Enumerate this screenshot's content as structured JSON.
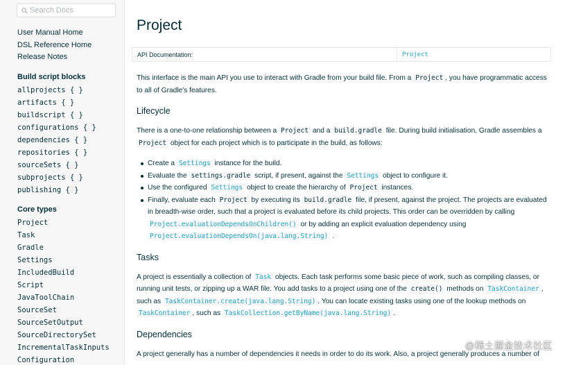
{
  "search": {
    "placeholder": "Search Docs",
    "icon": "search-icon"
  },
  "sidebar": {
    "top_links": [
      "User Manual Home",
      "DSL Reference Home",
      "Release Notes"
    ],
    "build_blocks_title": "Build script blocks",
    "build_blocks": [
      "allprojects { }",
      "artifacts { }",
      "buildscript { }",
      "configurations { }",
      "dependencies { }",
      "repositories { }",
      "sourceSets { }",
      "subprojects { }",
      "publishing { }"
    ],
    "core_types_title": "Core types",
    "core_types": [
      "Project",
      "Task",
      "Gradle",
      "Settings",
      "IncludedBuild",
      "Script",
      "JavaToolChain",
      "SourceSet",
      "SourceSetOutput",
      "SourceDirectorySet",
      "IncrementalTaskInputs",
      "Configuration"
    ]
  },
  "page": {
    "title": "Project",
    "api_doc_label": "API Documentation:",
    "api_doc_value": "Project",
    "intro": {
      "t1": "This interface is the main API you use to interact with Gradle from your build file. From a ",
      "c1": "Project",
      "t2": ", you have programmatic access to all of Gradle's features."
    },
    "lifecycle": {
      "heading": "Lifecycle",
      "t1": "There is a one-to-one relationship between a ",
      "c1": "Project",
      "t2": " and a ",
      "c2": "build.gradle",
      "t3": " file. During build initialisation, Gradle assembles a ",
      "c3": "Project",
      "t4": " object for each project which is to participate in the build, as follows:",
      "b1": {
        "t1": "Create a ",
        "c1": "Settings",
        "t2": " instance for the build."
      },
      "b2": {
        "t1": "Evaluate the ",
        "c1": "settings.gradle",
        "t2": " script, if present, against the ",
        "c2": "Settings",
        "t3": " object to configure it."
      },
      "b3": {
        "t1": "Use the configured ",
        "c1": "Settings",
        "t2": " object to create the hierarchy of ",
        "c2": "Project",
        "t3": " instances."
      },
      "b4": {
        "t1": "Finally, evaluate each ",
        "c1": "Project",
        "t2": " by executing its ",
        "c2": "build.gradle",
        "t3": " file, if present, against the project. The projects are evaluated in breadth-wise order, such that a project is evaluated before its child projects. This order can be overridden by calling ",
        "c3": "Project.evaluationDependsOnChildren()",
        "t4": " or by adding an explicit evaluation dependency using ",
        "c4": "Project.evaluationDependsOn(java.lang.String)",
        "t5": " ."
      }
    },
    "tasks": {
      "heading": "Tasks",
      "t1": "A project is essentially a collection of ",
      "c1": "Task",
      "t2": " objects. Each task performs some basic piece of work, such as compiling classes, or running unit tests, or zipping up a WAR file. You add tasks to a project using one of the ",
      "c2": "create()",
      "t3": " methods on ",
      "c3": "TaskContainer",
      "t4": ", such as ",
      "c4": "TaskContainer.create(java.lang.String)",
      "t5": ". You can locate existing tasks using one of the lookup methods on ",
      "c5": "TaskContainer",
      "t6": ", such as ",
      "c6": "TaskCollection.getByName(java.lang.String)",
      "t7": "."
    },
    "dependencies": {
      "heading": "Dependencies",
      "t1": "A project generally has a number of dependencies it needs in order to do its work. Also, a project generally produces a number of"
    }
  },
  "watermark": "@稀土掘金技术社区",
  "colors": {
    "text": "#02303a",
    "link": "#1ba8cb",
    "sidebar_bg": "#f7f7f8",
    "border": "#e6e6e8"
  }
}
